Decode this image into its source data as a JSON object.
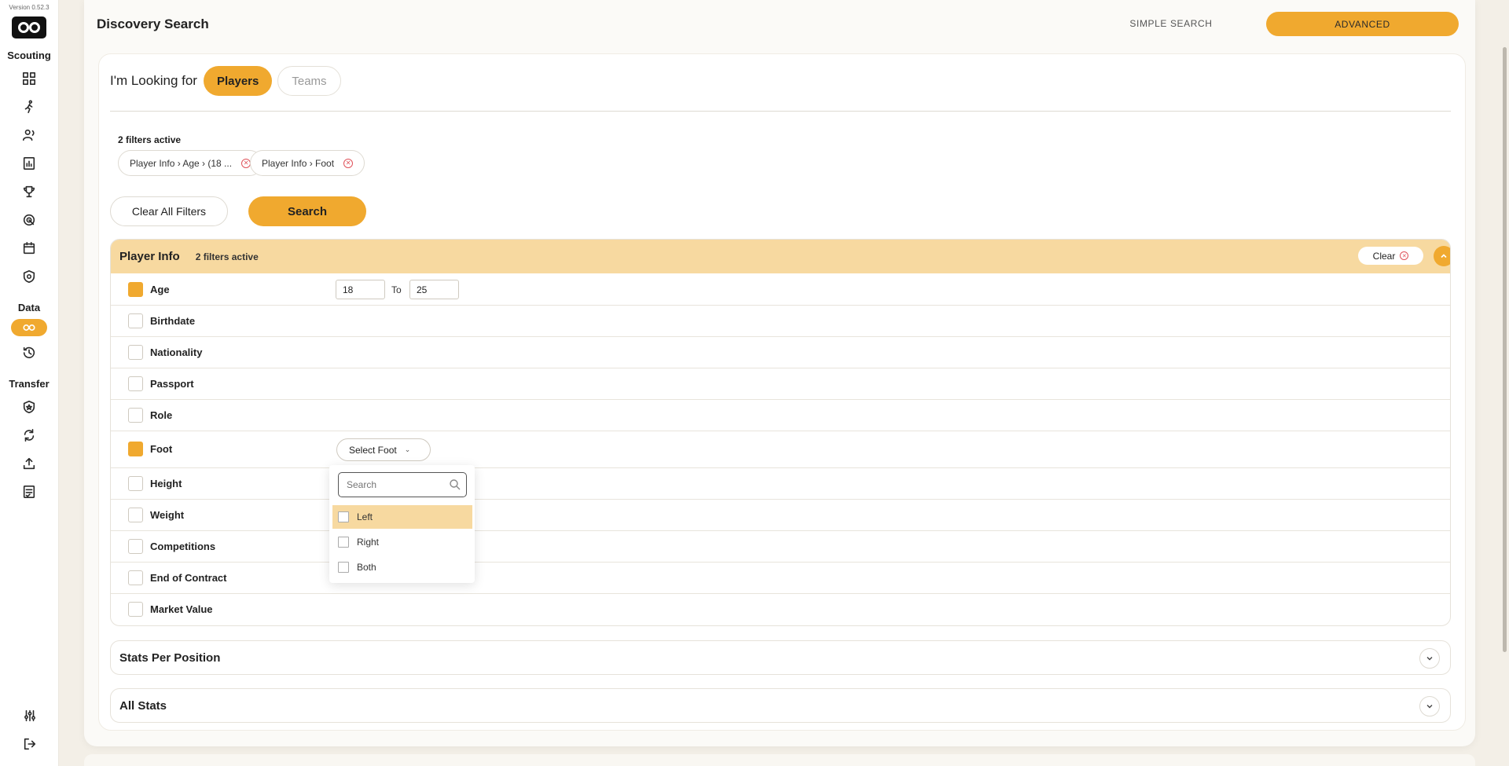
{
  "sidebar": {
    "version": "Version 0.52.3",
    "sections": [
      {
        "label": "Scouting"
      },
      {
        "label": "Data"
      },
      {
        "label": "Transfer"
      }
    ]
  },
  "header": {
    "title": "Discovery Search",
    "simple_label": "SIMPLE SEARCH",
    "advanced_label": "ADVANCED"
  },
  "search": {
    "looking_label": "I'm Looking for",
    "tab_players": "Players",
    "tab_teams": "Teams",
    "filters_active": "2 filters active",
    "chips": [
      {
        "label": "Player Info › Age › (18 ..."
      },
      {
        "label": "Player Info › Foot"
      }
    ],
    "clear_all_label": "Clear All Filters",
    "search_label": "Search"
  },
  "player_info": {
    "title": "Player Info",
    "active": "2 filters active",
    "clear_label": "Clear",
    "filters": [
      {
        "label": "Age",
        "checked": true
      },
      {
        "label": "Birthdate",
        "checked": false
      },
      {
        "label": "Nationality",
        "checked": false
      },
      {
        "label": "Passport",
        "checked": false
      },
      {
        "label": "Role",
        "checked": false
      },
      {
        "label": "Foot",
        "checked": true
      },
      {
        "label": "Height",
        "checked": false
      },
      {
        "label": "Weight",
        "checked": false
      },
      {
        "label": "Competitions",
        "checked": false
      },
      {
        "label": "End of Contract",
        "checked": false
      },
      {
        "label": "Market Value",
        "checked": false
      }
    ],
    "age_from": "18",
    "age_to_label": "To",
    "age_to": "25",
    "select_foot_label": "Select Foot"
  },
  "foot_dropdown": {
    "search_placeholder": "Search",
    "options": [
      "Left",
      "Right",
      "Both"
    ],
    "highlighted": "Left"
  },
  "collapsed_panels": [
    {
      "title": "Stats Per Position"
    },
    {
      "title": "All Stats"
    }
  ],
  "colors": {
    "accent": "#f0a92f",
    "accent_light": "#f7d9a0",
    "remove_red": "#e0525a"
  }
}
